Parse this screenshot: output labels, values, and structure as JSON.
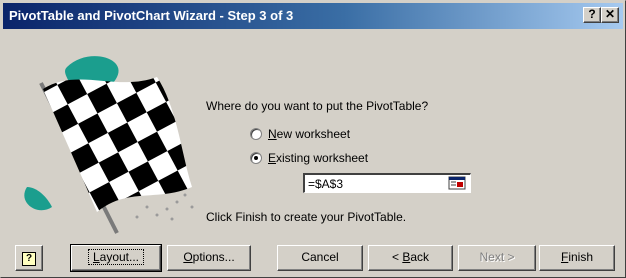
{
  "window": {
    "title": "PivotTable and PivotChart Wizard - Step 3 of 3",
    "help_glyph": "?",
    "close_glyph": "✕"
  },
  "question": "Where do you want to put the PivotTable?",
  "options": [
    {
      "label_pre": "",
      "label_key": "N",
      "label_post": "ew worksheet",
      "selected": false
    },
    {
      "label_pre": "",
      "label_key": "E",
      "label_post": "xisting worksheet",
      "selected": true
    }
  ],
  "reference": {
    "value": "=$A$3",
    "icon": "collapse-dialog-icon"
  },
  "finish_note": "Click Finish to create your PivotTable.",
  "buttons": {
    "help": "?",
    "layout": {
      "key": "L",
      "post": "ayout..."
    },
    "options": {
      "key": "O",
      "post": "ptions..."
    },
    "cancel": "Cancel",
    "back": {
      "pre": "< ",
      "key": "B",
      "post": "ack"
    },
    "next": "Next >",
    "finish": {
      "key": "F",
      "post": "inish"
    }
  },
  "colors": {
    "title_start": "#0a246a",
    "title_end": "#a6caf0",
    "face": "#d4d0c8",
    "flag_teal": "#1b9e8e"
  }
}
